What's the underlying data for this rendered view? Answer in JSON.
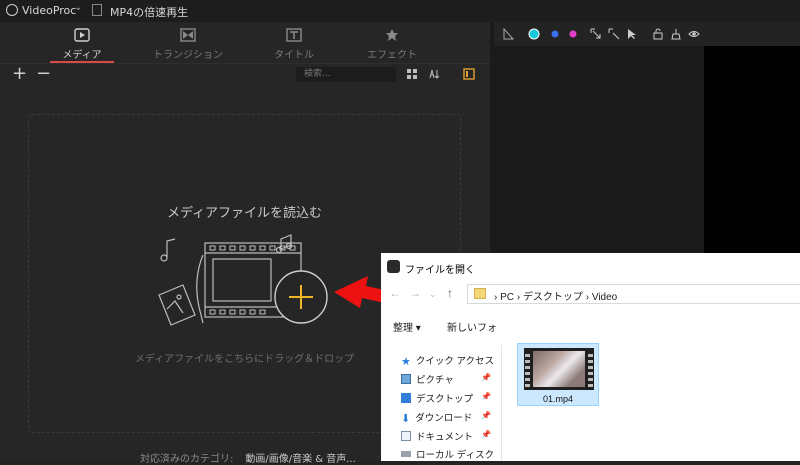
{
  "titlebar": {
    "app_name": "VideoProc",
    "project_name": "MP4の倍速再生"
  },
  "tabs": [
    {
      "label": "メディア",
      "icon": "media-icon",
      "active": true
    },
    {
      "label": "トランジション",
      "icon": "transition-icon",
      "active": false
    },
    {
      "label": "タイトル",
      "icon": "title-icon",
      "active": false
    },
    {
      "label": "エフェクト",
      "icon": "effect-icon",
      "active": false
    }
  ],
  "toolbar": {
    "add": "+",
    "remove": "−",
    "search_placeholder": "検索..."
  },
  "dropzone": {
    "title": "メディアファイルを読込む",
    "subtitle": "メディアファイルをこちらにドラッグ＆ドロップ",
    "supported_label": "対応済みのカテゴリ:",
    "supported_value": "動画/画像/音楽 & 音声..."
  },
  "dialog": {
    "title": "ファイルを開く",
    "breadcrumb": [
      "PC",
      "デスクトップ",
      "Video"
    ],
    "organize": "整理 ▾",
    "new_folder": "新しいフォ",
    "sidebar": [
      "クイック アクセス",
      "ピクチャ",
      "デスクトップ",
      "ダウンロード",
      "ドキュメント",
      "ローカル ディスク"
    ],
    "file": {
      "name": "01.mp4"
    }
  },
  "colors": {
    "accent_red": "#d84a4a",
    "selection": "#cce8ff",
    "arrow": "#ee1111"
  }
}
